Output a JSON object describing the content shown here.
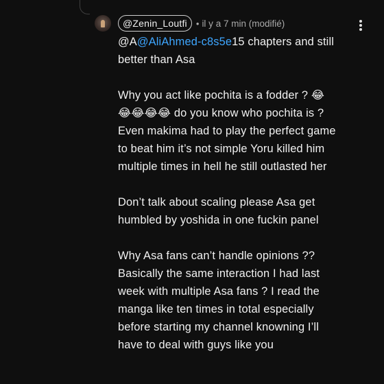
{
  "comment": {
    "author": "@Zenin_Loutfi",
    "separator": "•",
    "meta": "il y a 7 min (modifié)",
    "mention_prefix": "@A",
    "mention": "@AliAhmed-c8s5e",
    "line1_rest": "15 chapters and still",
    "line2": "better than Asa",
    "p2": [
      "Why you act like pochita is a fodder ? 😂",
      "😂😂😂😂 do you know who pochita is ?",
      "Even makima had to play the perfect game",
      "to beat him it’s not simple Yoru killed him",
      "multiple times in hell he still outlasted her"
    ],
    "p3": [
      "Don’t talk about scaling please Asa get",
      "humbled by yoshida in one fuckin panel"
    ],
    "p4": [
      "Why Asa fans can’t handle opinions ??",
      "Basically the same interaction I had last",
      "week with multiple Asa fans ? I read the",
      "manga like ten times in total especially",
      "before starting my channel knowning I’ll",
      "have to deal with guys like you"
    ]
  },
  "icons": {
    "more": "more-vertical-icon",
    "avatar": "user-avatar"
  },
  "colors": {
    "background": "#0f0f0f",
    "text": "#f1f1f1",
    "meta": "#aaaaaa",
    "mention": "#3ea6ff"
  }
}
